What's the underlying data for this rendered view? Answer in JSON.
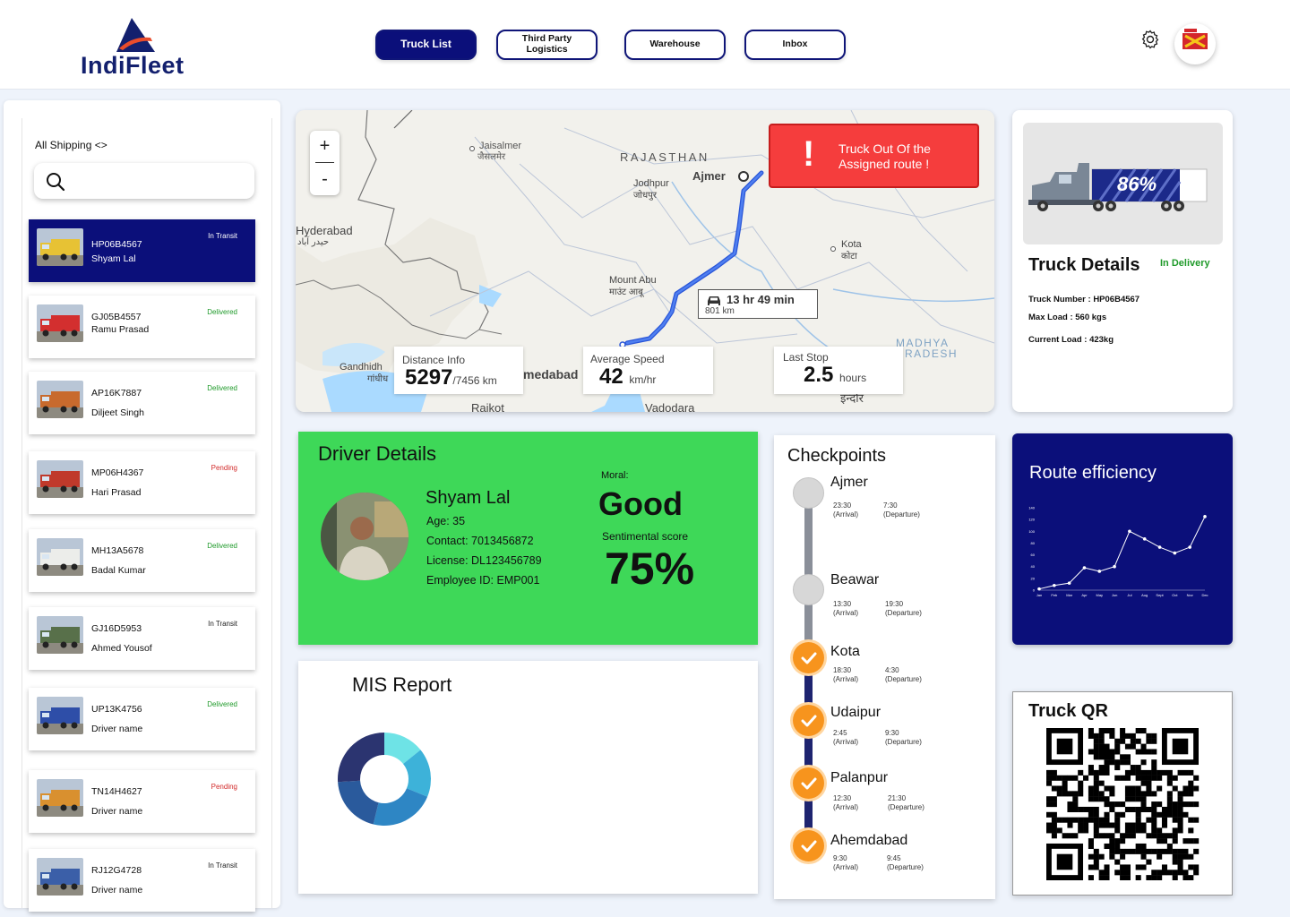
{
  "brand": {
    "name": "IndiFleet"
  },
  "nav": [
    {
      "label": "Truck List",
      "active": true
    },
    {
      "label": "Third Party Logistics",
      "active": false
    },
    {
      "label": "Warehouse",
      "active": false
    },
    {
      "label": "Inbox",
      "active": false
    }
  ],
  "header_icons": [
    "gear-icon",
    "profile-avatar"
  ],
  "sidebar": {
    "filter_label": "All Shipping <>",
    "search_placeholder": "",
    "trucks": [
      {
        "number": "HP06B4567",
        "driver": "Shyam Lal",
        "status": "In Transit",
        "selected": true
      },
      {
        "number": "GJ05B4557",
        "driver": "Ramu Prasad",
        "status": "Delivered"
      },
      {
        "number": "AP16K7887",
        "driver": "Diljeet Singh",
        "status": "Delivered"
      },
      {
        "number": "MP06H4367",
        "driver": "Hari Prasad",
        "status": "Pending"
      },
      {
        "number": "MH13A5678",
        "driver": "Badal Kumar",
        "status": "Delivered"
      },
      {
        "number": "GJ16D5953",
        "driver": "Ahmed Yousof",
        "status": "In Transit"
      },
      {
        "number": "UP13K4756",
        "driver": "Driver name",
        "status": "Delivered"
      },
      {
        "number": "TN14H4627",
        "driver": "Driver name",
        "status": "Pending"
      },
      {
        "number": "RJ12G4728",
        "driver": "Driver name",
        "status": "In Transit"
      }
    ]
  },
  "map": {
    "places": {
      "jaisalmer": "Jaisalmer",
      "jaisalmer_hi": "जैसलमेर",
      "rajasthan": "RAJASTHAN",
      "ajmer": "Ajmer",
      "jodhpur": "Jodhpur",
      "jodhpur_hi": "जोधपुर",
      "hyderabad": "Hyderabad",
      "hyderabad_ur": "حیدر آباد",
      "kota": "Kota",
      "kota_hi": "कोटा",
      "mount_abu": "Mount Abu",
      "mount_abu_hi": "माउंट आबू",
      "madhya": "MADHYA",
      "pradesh": "RADESH",
      "gandhidham": "Gandhidh",
      "gandhidham_hi": "गांधीध",
      "ahmedabad": "medabad",
      "rajkot": "Rajkot",
      "vadodara": "Vadodara",
      "indore_hi": "इन्दौर"
    },
    "zoom_in": "+",
    "zoom_out": "-",
    "alert": {
      "mark": "!",
      "text": "Truck Out Of the Assigned route !"
    },
    "route": {
      "time": "13 hr 49 min",
      "distance": "801 km"
    },
    "distance_info": {
      "label": "Distance Info",
      "value": "5297",
      "suffix": "/7456 km"
    },
    "avg_speed": {
      "label": "Average Speed",
      "value": "42",
      "unit": "km/hr"
    },
    "last_stop": {
      "label": "Last Stop",
      "value": "2.5",
      "unit": "hours"
    }
  },
  "truck_details": {
    "load_percent": "86%",
    "title": "Truck Details",
    "status": "In Delivery",
    "number": "Truck Number : HP06B4567",
    "max_load": "Max Load : 560 kgs",
    "current_load": "Current Load : 423kg"
  },
  "driver": {
    "title": "Driver Details",
    "name": "Shyam Lal",
    "age": "Age: 35",
    "contact": "Contact: 7013456872",
    "license": "License: DL123456789",
    "employee_id": "Employee ID: EMP001",
    "moral_label": "Moral:",
    "moral_value": "Good",
    "sentiment_label": "Sentimental score",
    "sentiment_value": "75%"
  },
  "mis": {
    "title": "MIS Report"
  },
  "checkpoints": {
    "title": "Checkpoints",
    "items": [
      {
        "name": "Ajmer",
        "arrival": "23:30",
        "departure": "7:30",
        "done": false
      },
      {
        "name": "Beawar",
        "arrival": "13:30",
        "departure": "19:30",
        "done": false
      },
      {
        "name": "Kota",
        "arrival": "18:30",
        "departure": "4:30",
        "done": true
      },
      {
        "name": "Udaipur",
        "arrival": "2:45",
        "departure": "9:30",
        "done": true
      },
      {
        "name": "Palanpur",
        "arrival": "12:30",
        "departure": "21:30",
        "done": true
      },
      {
        "name": "Ahemdabad",
        "arrival": "9:30",
        "departure": "9:45",
        "done": true
      }
    ],
    "arrival_label": "(Arrival)",
    "departure_label": "(Departure)"
  },
  "route_efficiency": {
    "title": "Route efficiency"
  },
  "truck_qr": {
    "title": "Truck QR"
  },
  "chart_data": [
    {
      "type": "line",
      "categories": [
        "Jan",
        "Feb",
        "Mar",
        "Apr",
        "May",
        "Jun",
        "Jul",
        "Aug",
        "Sept",
        "Oct",
        "Nov",
        "Dec"
      ],
      "values": [
        2,
        8,
        12,
        38,
        32,
        40,
        100,
        87,
        73,
        63,
        73,
        125
      ],
      "ylim": [
        0,
        140
      ]
    },
    {
      "type": "pie",
      "slices": [
        {
          "value": 14.2
        },
        {
          "value": 17.0
        },
        {
          "value": 22.6
        },
        {
          "value": 20.2
        },
        {
          "value": 26.0
        }
      ],
      "colors": [
        "#6ee3e6",
        "#3db2d9",
        "#2e86c4",
        "#2a5a9c",
        "#2b3470"
      ]
    }
  ]
}
